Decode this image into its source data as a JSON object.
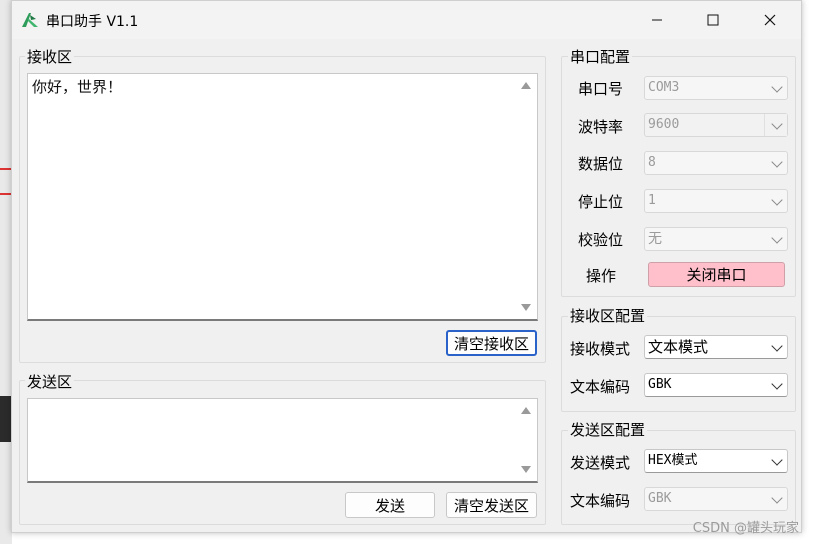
{
  "window": {
    "title": "串口助手 V1.1"
  },
  "receive": {
    "group_title": "接收区",
    "text": "你好，世界！",
    "clear_button": "清空接收区"
  },
  "send": {
    "group_title": "发送区",
    "text": "",
    "send_button": "发送",
    "clear_button": "清空发送区"
  },
  "serial": {
    "group_title": "串口配置",
    "port_label": "串口号",
    "port_value": "COM3",
    "baud_label": "波特率",
    "baud_value": "9600",
    "databits_label": "数据位",
    "databits_value": "8",
    "stopbits_label": "停止位",
    "stopbits_value": "1",
    "parity_label": "校验位",
    "parity_value": "无",
    "action_label": "操作",
    "action_button": "关闭串口"
  },
  "recv_config": {
    "group_title": "接收区配置",
    "mode_label": "接收模式",
    "mode_value": "文本模式",
    "encoding_label": "文本编码",
    "encoding_value": "GBK"
  },
  "send_config": {
    "group_title": "发送区配置",
    "mode_label": "发送模式",
    "mode_value": "HEX模式",
    "encoding_label": "文本编码",
    "encoding_value": "GBK"
  },
  "watermark": "CSDN @罐头玩家",
  "colors": {
    "close_port_button": "#ffc0cb",
    "focus_border": "#2a62c9"
  }
}
